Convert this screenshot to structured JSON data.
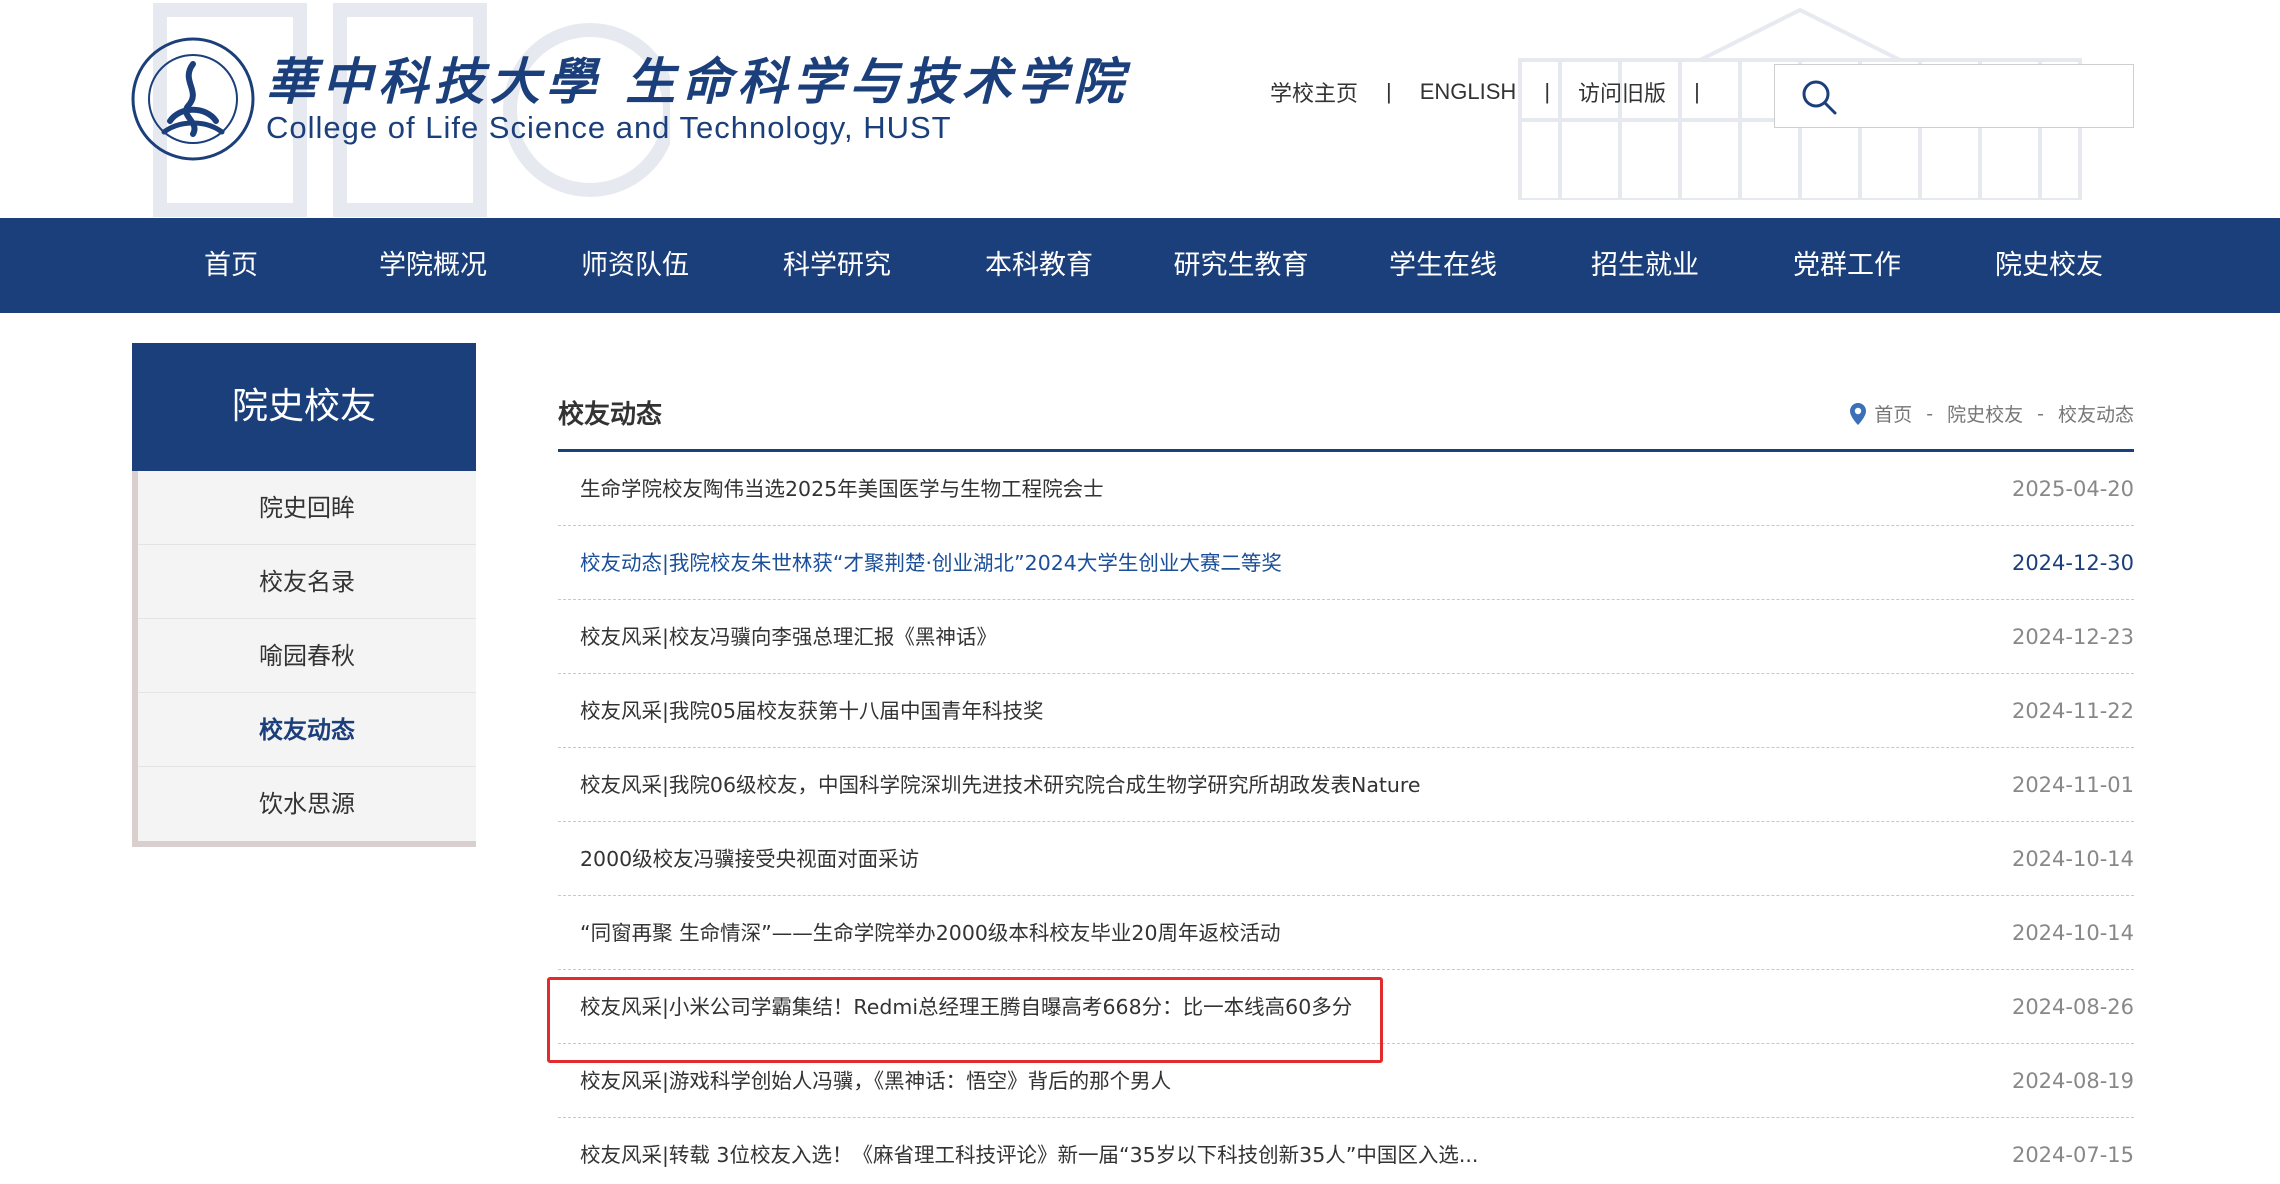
{
  "header": {
    "logo_cn": "華中科技大學 生命科学与技术学院",
    "logo_en": "College of Life Science and Technology, HUST",
    "toplinks": [
      "学校主页",
      "ENGLISH",
      "访问旧版"
    ],
    "separator": "|",
    "search_placeholder": ""
  },
  "nav": [
    "首页",
    "学院概况",
    "师资队伍",
    "科学研究",
    "本科教育",
    "研究生教育",
    "学生在线",
    "招生就业",
    "党群工作",
    "院史校友"
  ],
  "sidebar": {
    "title": "院史校友",
    "items": [
      "院史回眸",
      "校友名录",
      "喻园春秋",
      "校友动态",
      "饮水思源"
    ],
    "active_index": 3
  },
  "main": {
    "title": "校友动态",
    "breadcrumb": [
      "首页",
      "院史校友",
      "校友动态"
    ],
    "breadcrumb_sep": "-",
    "news": [
      {
        "title": "生命学院校友陶伟当选2025年美国医学与生物工程院会士",
        "date": "2025-04-20"
      },
      {
        "title": "校友动态|我院校友朱世林获“才聚荆楚·创业湖北”2024大学生创业大赛二等奖",
        "date": "2024-12-30"
      },
      {
        "title": "校友风采|校友冯骥向李强总理汇报《黑神话》",
        "date": "2024-12-23"
      },
      {
        "title": "校友风采|我院05届校友获第十八届中国青年科技奖",
        "date": "2024-11-22"
      },
      {
        "title": "校友风采|我院06级校友，中国科学院深圳先进技术研究院合成生物学研究所胡政发表Nature",
        "date": "2024-11-01"
      },
      {
        "title": "2000级校友冯骥接受央视面对面采访",
        "date": "2024-10-14"
      },
      {
        "title": "“同窗再聚 生命情深”——生命学院举办2000级本科校友毕业20周年返校活动",
        "date": "2024-10-14"
      },
      {
        "title": "校友风采|小米公司学霸集结！Redmi总经理王腾自曝高考668分：比一本线高60多分",
        "date": "2024-08-26"
      },
      {
        "title": "校友风采|游戏科学创始人冯骥，《黑神话：悟空》背后的那个男人",
        "date": "2024-08-19"
      },
      {
        "title": "校友风采|转载 3位校友入选！《麻省理工科技评论》新一届“35岁以下科技创新35人”中国区入选...",
        "date": "2024-07-15"
      }
    ],
    "highlighted_index": 1,
    "boxed_index": 7
  },
  "colors": {
    "primary": "#1b3f7a",
    "annotation": "#e32b2b"
  }
}
